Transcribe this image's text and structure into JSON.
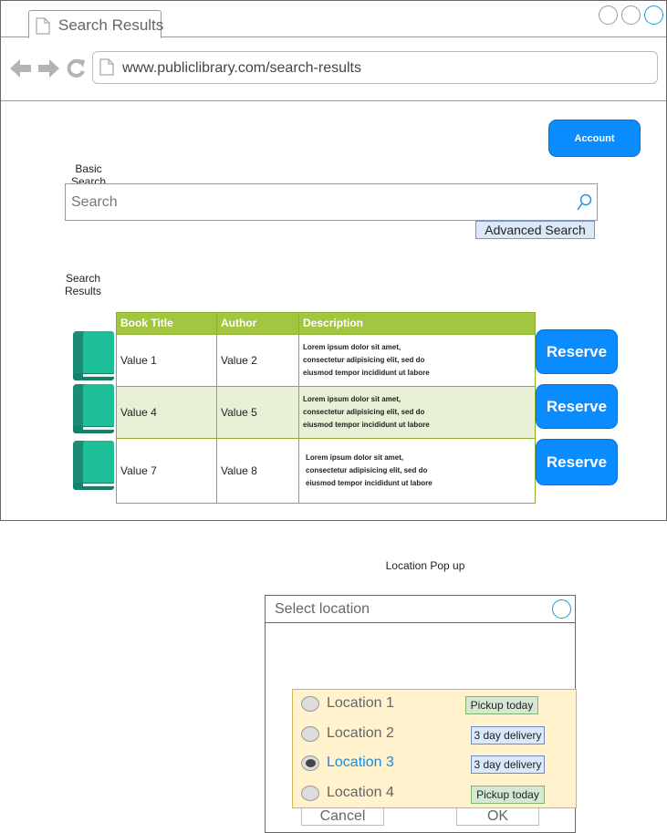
{
  "browser": {
    "tab_title": "Search Results",
    "url": "www.publiclibrary.com/search-results"
  },
  "header": {
    "account_label": "Account"
  },
  "search": {
    "section_label": "Basic Search",
    "placeholder": "Search",
    "advanced_label": "Advanced Search"
  },
  "results": {
    "section_label": "Search Results",
    "columns": [
      "Book Title",
      "Author",
      "Description"
    ],
    "rows": [
      {
        "title": "Value 1",
        "author": "Value 2",
        "desc": [
          "Lorem ipsum dolor sit amet,",
          "consectetur adipisicing elit, sed do",
          "eiusmod tempor incididunt ut labore"
        ],
        "reserve_label": "Reserve"
      },
      {
        "title": "Value 4",
        "author": "Value 5",
        "desc": [
          "Lorem ipsum dolor sit amet,",
          "consectetur adipisicing elit, sed do",
          "eiusmod tempor incididunt ut labore"
        ],
        "reserve_label": "Reserve"
      },
      {
        "title": "Value 7",
        "author": "Value 8",
        "desc": [
          "Lorem ipsum dolor sit amet,",
          "consectetur adipisicing elit, sed do",
          "eiusmod tempor incididunt ut labore"
        ],
        "reserve_label": "Reserve"
      }
    ]
  },
  "popup": {
    "caption": "Location Pop up",
    "title": "Select location",
    "locations": [
      {
        "label": "Location 1",
        "badge": "Pickup today",
        "selected": false
      },
      {
        "label": "Location 2",
        "badge": "3 day delivery",
        "selected": false
      },
      {
        "label": "Location 3",
        "badge": "3 day delivery",
        "selected": true
      },
      {
        "label": "Location 4",
        "badge": "Pickup today",
        "selected": false
      }
    ],
    "cancel_label": "Cancel",
    "ok_label": "OK"
  },
  "colors": {
    "accent": "#0a8cff",
    "table_header": "#a2c63f",
    "table_alt_row": "#e8f0d6",
    "popup_panel": "#fff2cc",
    "badge_green": "#d5e8d4",
    "badge_blue": "#dae8fc",
    "selected_text": "#1a8cdf"
  },
  "icons": [
    "document-icon",
    "back-arrow-icon",
    "forward-arrow-icon",
    "refresh-icon",
    "search-icon",
    "book-icon",
    "radio-icon"
  ]
}
